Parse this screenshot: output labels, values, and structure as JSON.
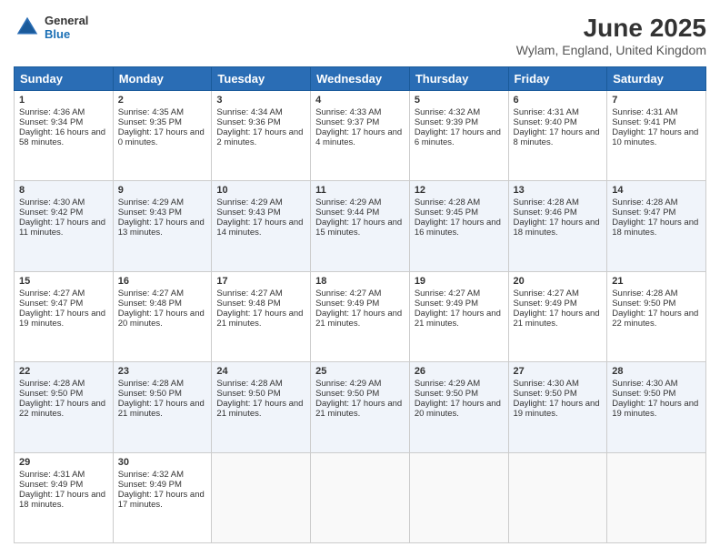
{
  "logo": {
    "general": "General",
    "blue": "Blue"
  },
  "title": "June 2025",
  "subtitle": "Wylam, England, United Kingdom",
  "days": [
    "Sunday",
    "Monday",
    "Tuesday",
    "Wednesday",
    "Thursday",
    "Friday",
    "Saturday"
  ],
  "weeks": [
    [
      {
        "day": "1",
        "sunrise": "4:36 AM",
        "sunset": "9:34 PM",
        "daylight": "16 hours and 58 minutes."
      },
      {
        "day": "2",
        "sunrise": "4:35 AM",
        "sunset": "9:35 PM",
        "daylight": "17 hours and 0 minutes."
      },
      {
        "day": "3",
        "sunrise": "4:34 AM",
        "sunset": "9:36 PM",
        "daylight": "17 hours and 2 minutes."
      },
      {
        "day": "4",
        "sunrise": "4:33 AM",
        "sunset": "9:37 PM",
        "daylight": "17 hours and 4 minutes."
      },
      {
        "day": "5",
        "sunrise": "4:32 AM",
        "sunset": "9:39 PM",
        "daylight": "17 hours and 6 minutes."
      },
      {
        "day": "6",
        "sunrise": "4:31 AM",
        "sunset": "9:40 PM",
        "daylight": "17 hours and 8 minutes."
      },
      {
        "day": "7",
        "sunrise": "4:31 AM",
        "sunset": "9:41 PM",
        "daylight": "17 hours and 10 minutes."
      }
    ],
    [
      {
        "day": "8",
        "sunrise": "4:30 AM",
        "sunset": "9:42 PM",
        "daylight": "17 hours and 11 minutes."
      },
      {
        "day": "9",
        "sunrise": "4:29 AM",
        "sunset": "9:43 PM",
        "daylight": "17 hours and 13 minutes."
      },
      {
        "day": "10",
        "sunrise": "4:29 AM",
        "sunset": "9:43 PM",
        "daylight": "17 hours and 14 minutes."
      },
      {
        "day": "11",
        "sunrise": "4:29 AM",
        "sunset": "9:44 PM",
        "daylight": "17 hours and 15 minutes."
      },
      {
        "day": "12",
        "sunrise": "4:28 AM",
        "sunset": "9:45 PM",
        "daylight": "17 hours and 16 minutes."
      },
      {
        "day": "13",
        "sunrise": "4:28 AM",
        "sunset": "9:46 PM",
        "daylight": "17 hours and 18 minutes."
      },
      {
        "day": "14",
        "sunrise": "4:28 AM",
        "sunset": "9:47 PM",
        "daylight": "17 hours and 18 minutes."
      }
    ],
    [
      {
        "day": "15",
        "sunrise": "4:27 AM",
        "sunset": "9:47 PM",
        "daylight": "17 hours and 19 minutes."
      },
      {
        "day": "16",
        "sunrise": "4:27 AM",
        "sunset": "9:48 PM",
        "daylight": "17 hours and 20 minutes."
      },
      {
        "day": "17",
        "sunrise": "4:27 AM",
        "sunset": "9:48 PM",
        "daylight": "17 hours and 21 minutes."
      },
      {
        "day": "18",
        "sunrise": "4:27 AM",
        "sunset": "9:49 PM",
        "daylight": "17 hours and 21 minutes."
      },
      {
        "day": "19",
        "sunrise": "4:27 AM",
        "sunset": "9:49 PM",
        "daylight": "17 hours and 21 minutes."
      },
      {
        "day": "20",
        "sunrise": "4:27 AM",
        "sunset": "9:49 PM",
        "daylight": "17 hours and 21 minutes."
      },
      {
        "day": "21",
        "sunrise": "4:28 AM",
        "sunset": "9:50 PM",
        "daylight": "17 hours and 22 minutes."
      }
    ],
    [
      {
        "day": "22",
        "sunrise": "4:28 AM",
        "sunset": "9:50 PM",
        "daylight": "17 hours and 22 minutes."
      },
      {
        "day": "23",
        "sunrise": "4:28 AM",
        "sunset": "9:50 PM",
        "daylight": "17 hours and 21 minutes."
      },
      {
        "day": "24",
        "sunrise": "4:28 AM",
        "sunset": "9:50 PM",
        "daylight": "17 hours and 21 minutes."
      },
      {
        "day": "25",
        "sunrise": "4:29 AM",
        "sunset": "9:50 PM",
        "daylight": "17 hours and 21 minutes."
      },
      {
        "day": "26",
        "sunrise": "4:29 AM",
        "sunset": "9:50 PM",
        "daylight": "17 hours and 20 minutes."
      },
      {
        "day": "27",
        "sunrise": "4:30 AM",
        "sunset": "9:50 PM",
        "daylight": "17 hours and 19 minutes."
      },
      {
        "day": "28",
        "sunrise": "4:30 AM",
        "sunset": "9:50 PM",
        "daylight": "17 hours and 19 minutes."
      }
    ],
    [
      {
        "day": "29",
        "sunrise": "4:31 AM",
        "sunset": "9:49 PM",
        "daylight": "17 hours and 18 minutes."
      },
      {
        "day": "30",
        "sunrise": "4:32 AM",
        "sunset": "9:49 PM",
        "daylight": "17 hours and 17 minutes."
      },
      null,
      null,
      null,
      null,
      null
    ]
  ]
}
